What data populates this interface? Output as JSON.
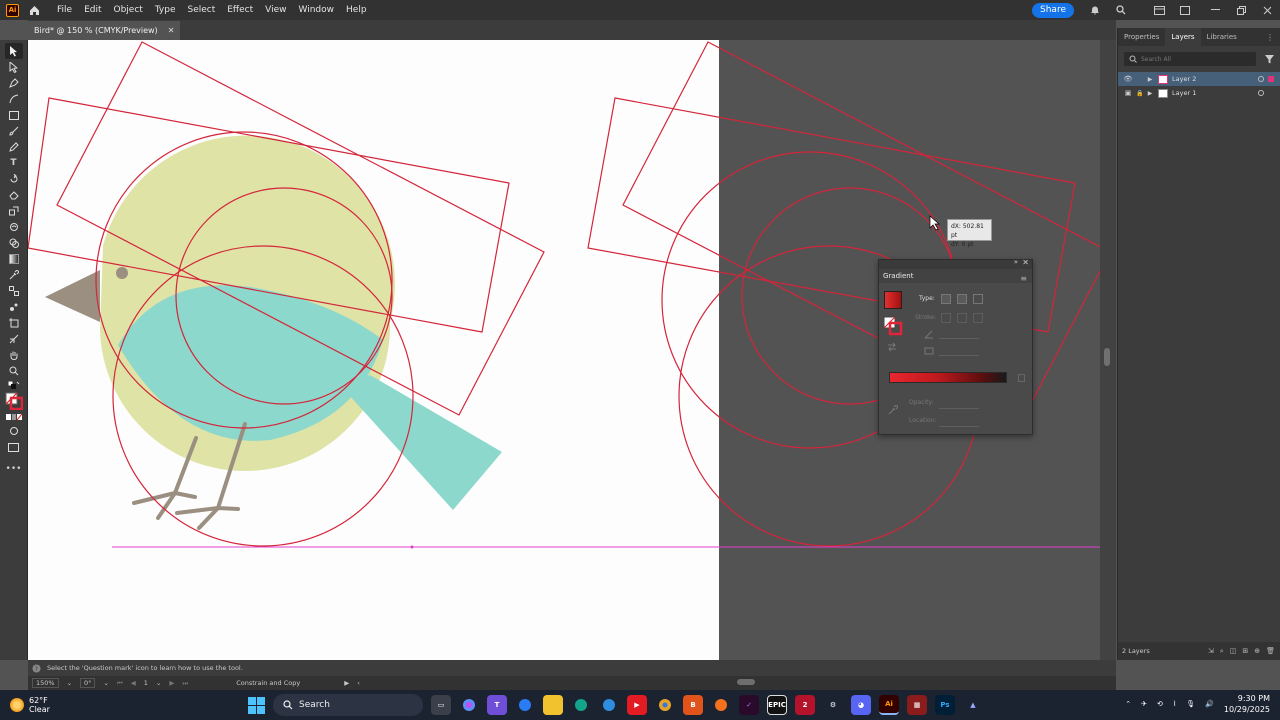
{
  "app": {
    "logo_text": "Ai"
  },
  "menubar": {
    "items": [
      "File",
      "Edit",
      "Object",
      "Type",
      "Select",
      "Effect",
      "View",
      "Window",
      "Help"
    ],
    "share_label": "Share"
  },
  "document": {
    "tab_title": "Bird* @ 150 % (CMYK/Preview)"
  },
  "tooltip": {
    "dx": "dX: 502.81 pt",
    "dy": "dY: 0 pt"
  },
  "gradient_panel": {
    "title": "Gradient",
    "type_label": "Type:",
    "stroke_label": "Stroke:",
    "opacity_label": "Opacity:",
    "location_label": "Location:"
  },
  "right_panel": {
    "tabs": [
      "Properties",
      "Layers",
      "Libraries"
    ],
    "active_tab": "Layers",
    "search_placeholder": "Search All",
    "layers": [
      {
        "name": "Layer 2",
        "selected": true,
        "locked": false
      },
      {
        "name": "Layer 1",
        "selected": false,
        "locked": true
      }
    ],
    "footer_count": "2 Layers"
  },
  "statusbar": {
    "hint": "Select the 'Question mark' icon to learn how to use the tool.",
    "zoom": "150%",
    "rotation": "0°",
    "artboard_number": "1",
    "status_action": "Constrain and Copy"
  },
  "taskbar": {
    "temperature": "62°F",
    "weather": "Clear",
    "search_label": "Search",
    "time": "9:30 PM",
    "date": "10/29/2025"
  },
  "colors": {
    "selection_red": "#d4253a",
    "guide_magenta": "#e040c8",
    "bird_yellow": "#dfe3a6",
    "bird_teal": "#8dd8cc",
    "bird_brown": "#9a8f80",
    "accent_blue": "#1473e6"
  }
}
